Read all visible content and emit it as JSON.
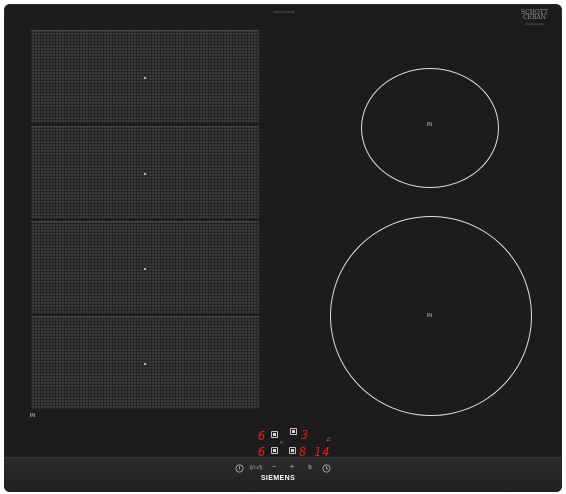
{
  "header": {
    "model_code": "EX675JYW1E",
    "maker_mark": "SCHOTT",
    "maker_mark_line2": "CERAN",
    "maker_sub": "Glaskeramik"
  },
  "flex_zones": [
    {
      "id": "zone-1"
    },
    {
      "id": "zone-2"
    },
    {
      "id": "zone-3"
    },
    {
      "id": "zone-4"
    }
  ],
  "flex_zone_label": "IN",
  "rings": {
    "top_label": "IN",
    "bottom_label": "IN"
  },
  "display": {
    "power_left_top": "6",
    "power_left_bottom": "6",
    "power_right_top": "3",
    "power_right_bottom": "8",
    "timer": "14",
    "link_mark": "|+|",
    "min_label": "min",
    "accent_red": "#e31d1d"
  },
  "controls": {
    "power_icon": "power-icon",
    "combine_label": "▯/▭/▯",
    "minus_label": "−",
    "plus_label": "+",
    "boost_label": "b",
    "timer_icon": "clock-icon"
  },
  "brand": "SIEMENS"
}
